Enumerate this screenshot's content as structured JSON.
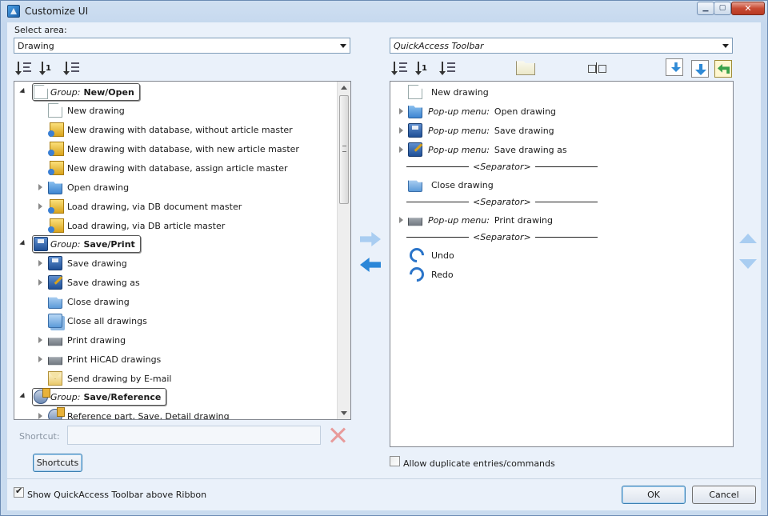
{
  "window": {
    "title": "Customize UI"
  },
  "left": {
    "select_area_label": "Select area:",
    "area_value": "Drawing",
    "tree": {
      "groups": [
        {
          "label": "Group:",
          "name": "New/Open"
        },
        {
          "label": "Group:",
          "name": "Save/Print"
        },
        {
          "label": "Group:",
          "name": "Save/Reference"
        }
      ],
      "items": [
        "New drawing",
        "New drawing with database, without article master",
        "New drawing with database, with new article master",
        "New drawing with database, assign article master",
        "Open drawing",
        "Load drawing, via DB document master",
        "Load drawing, via DB article master",
        "Save drawing",
        "Save drawing as",
        "Close drawing",
        "Close all drawings",
        "Print drawing",
        "Print HiCAD drawings",
        "Send drawing by E-mail",
        "Reference part, Save, Detail drawing"
      ]
    },
    "shortcut_label": "Shortcut:",
    "shortcut_value": "",
    "shortcuts_button": "Shortcuts"
  },
  "right": {
    "toolbar_value": "QuickAccess Toolbar",
    "entries": [
      {
        "prefix": "",
        "text": "New drawing"
      },
      {
        "prefix": "Pop-up menu:",
        "text": "Open drawing"
      },
      {
        "prefix": "Pop-up menu:",
        "text": "Save drawing"
      },
      {
        "prefix": "Pop-up menu:",
        "text": "Save drawing as"
      },
      {
        "prefix": "",
        "text": "Close drawing"
      },
      {
        "prefix": "Pop-up menu:",
        "text": "Print drawing"
      },
      {
        "prefix": "",
        "text": "Undo"
      },
      {
        "prefix": "",
        "text": "Redo"
      }
    ],
    "separator": "<Separator>",
    "allow_duplicates_label": "Allow duplicate entries/commands"
  },
  "footer": {
    "show_qat_label": "Show QuickAccess Toolbar above Ribbon",
    "ok": "OK",
    "cancel": "Cancel"
  },
  "state": {
    "allow_duplicates_checked": false,
    "show_qat_checked": true
  }
}
